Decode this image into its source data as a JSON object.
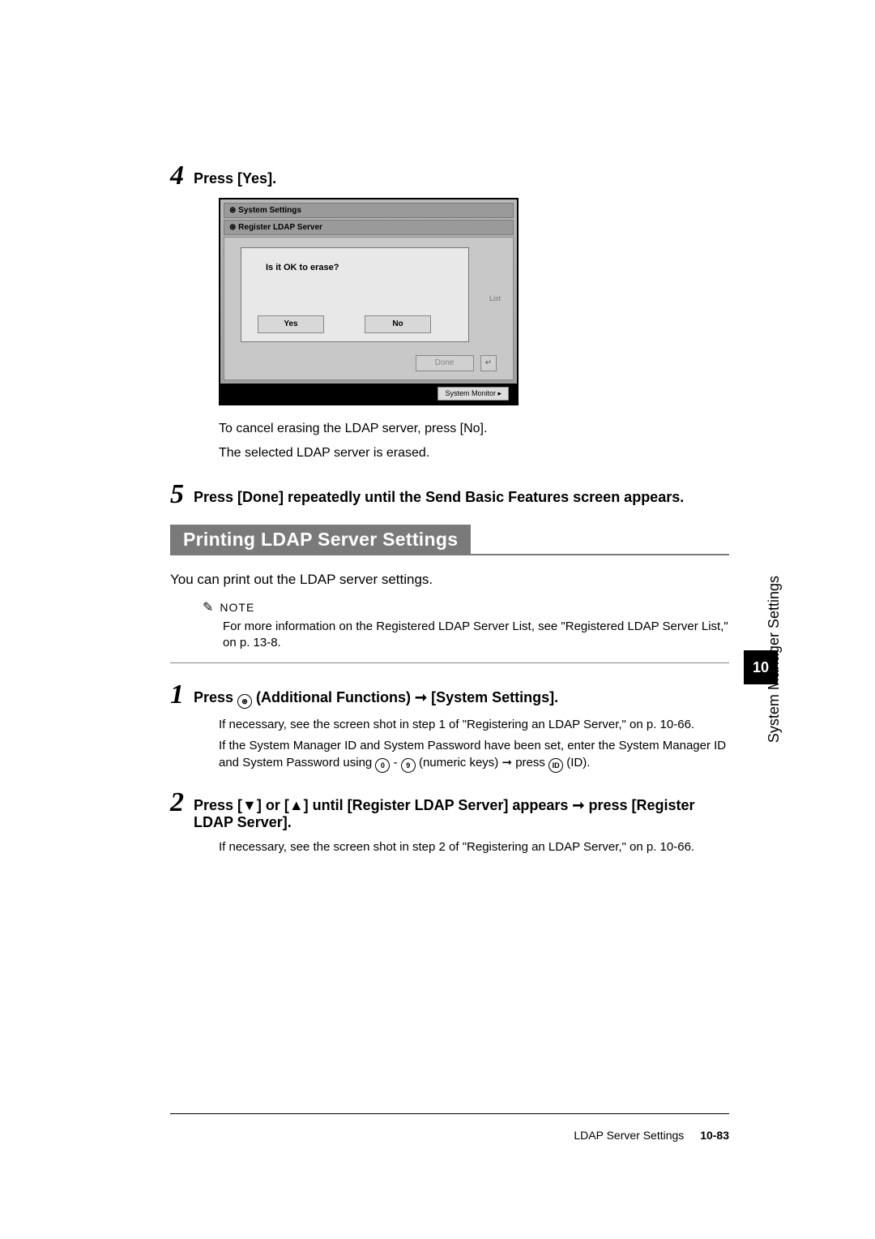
{
  "steps": {
    "s4": {
      "num": "4",
      "title": "Press [Yes].",
      "line1": "To cancel erasing the LDAP server, press [No].",
      "line2": "The selected LDAP server is erased."
    },
    "s5": {
      "num": "5",
      "title": "Press [Done] repeatedly until the Send Basic Features screen appears."
    },
    "s1": {
      "num": "1",
      "title_a": "Press ",
      "title_b": " (Additional Functions) ➞ [System Settings].",
      "line1": "If necessary, see the screen shot in step 1 of \"Registering an LDAP Server,\" on p. 10-66.",
      "line2a": "If the System Manager ID and System Password have been set, enter the System Manager ID and System Password using ",
      "line2b": " - ",
      "line2c": " (numeric keys) ➞ press ",
      "line2d": " (ID)."
    },
    "s2": {
      "num": "2",
      "title": "Press [▼] or [▲] until [Register LDAP Server] appears ➞ press [Register LDAP Server].",
      "line1": "If necessary, see the screen shot in step 2 of \"Registering an LDAP Server,\" on p. 10-66."
    }
  },
  "screenshot": {
    "title1": "⊛ System Settings",
    "title2": "⊛ Register LDAP Server",
    "prompt": "Is it OK to erase?",
    "yes": "Yes",
    "no": "No",
    "list": "List",
    "done": "Done",
    "sysmon": "System Monitor ▸"
  },
  "section": {
    "title": "Printing LDAP Server Settings",
    "intro": "You can print out the LDAP server settings."
  },
  "note": {
    "label": "NOTE",
    "text": "For more information on the Registered LDAP Server List, see \"Registered LDAP Server List,\" on p. 13-8."
  },
  "sidebar": {
    "label": "System Manager Settings",
    "chapter": "10"
  },
  "footer": {
    "section": "LDAP Server Settings",
    "page": "10-83"
  },
  "icons": {
    "af": "⊛",
    "k0": "0",
    "k9": "9",
    "id": "ID"
  }
}
